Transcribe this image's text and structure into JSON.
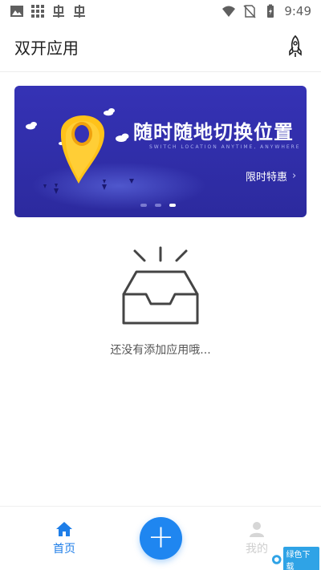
{
  "status_bar": {
    "time": "9:49",
    "left_icons": [
      "image-icon",
      "grid-icon",
      "bug-icon",
      "bug-icon"
    ],
    "right_icons": [
      "wifi-icon",
      "no-sim-icon",
      "battery-charging-icon"
    ]
  },
  "header": {
    "title": "双开应用",
    "action_icon": "rocket-icon"
  },
  "banner": {
    "title": "随时随地切换位置",
    "subtitle": "SWITCH LOCATION ANYTIME, ANYWHERE",
    "cta": "限时特惠",
    "cta_chevron": "›",
    "dots": 3,
    "active_dot": 2
  },
  "empty_state": {
    "icon": "empty-inbox-icon",
    "text": "还没有添加应用哦..."
  },
  "bottom_nav": {
    "home_label": "首页",
    "mine_label": "我的",
    "add_label": "+"
  },
  "watermark": {
    "text": "绿色下载"
  },
  "colors": {
    "accent": "#1f86f0",
    "banner_bg": "#3532b5",
    "pin": "#ffc21a"
  }
}
